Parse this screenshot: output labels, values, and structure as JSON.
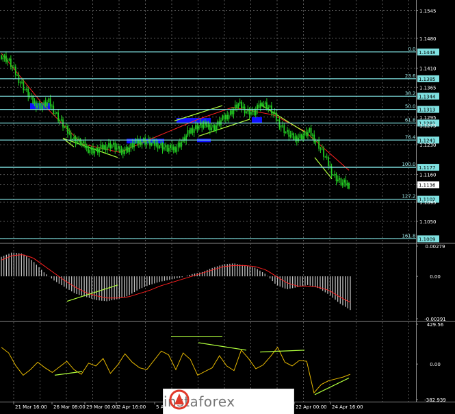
{
  "colors": {
    "background": "#000000",
    "grid": "#5a5a5a",
    "candle": "#22cc22",
    "fib": "#7fe0e0",
    "fib_label_bg": "#7fe0e0",
    "ma": "#ff2020",
    "trend": "#b0ff3c",
    "zone": "#1010ff",
    "histogram": "#bfbfbf",
    "signal": "#ff2020",
    "oscillator": "#e6b800",
    "divergence": "#b0ff3c",
    "watermark_bg": "#ffffff",
    "watermark_text": "#777777"
  },
  "chart_data": [
    {
      "type": "candlestick",
      "panel": "main",
      "y_ticks": [
        "1.1545",
        "1.1480",
        "1.1410",
        "1.1365",
        "1.1295",
        "1.1275",
        "1.1230",
        "1.1160",
        "1.1136",
        "1.1095",
        "1.1050",
        "1.1009"
      ],
      "current_price": "1.1136",
      "fib_levels": [
        {
          "pct": "0.0",
          "price": "1.1448"
        },
        {
          "pct": "23.6",
          "price": "1.1385"
        },
        {
          "pct": "38.2",
          "price": "1.1344"
        },
        {
          "pct": "50.0",
          "price": "1.1313"
        },
        {
          "pct": "61.8",
          "price": "1.1281"
        },
        {
          "pct": "76.4",
          "price": "1.1241"
        },
        {
          "pct": "100.0",
          "price": "1.1177"
        },
        {
          "pct": "127.2",
          "price": "1.1102"
        },
        {
          "pct": "161.8",
          "price": "1.1009"
        }
      ],
      "close_path": [
        [
          0,
          1.144
        ],
        [
          5,
          1.1425
        ],
        [
          10,
          1.139
        ],
        [
          15,
          1.136
        ],
        [
          20,
          1.133
        ],
        [
          25,
          1.132
        ],
        [
          30,
          1.133
        ],
        [
          35,
          1.13
        ],
        [
          40,
          1.127
        ],
        [
          45,
          1.1245
        ],
        [
          50,
          1.1235
        ],
        [
          55,
          1.122
        ],
        [
          60,
          1.1215
        ],
        [
          65,
          1.1225
        ],
        [
          70,
          1.123
        ],
        [
          75,
          1.1215
        ],
        [
          80,
          1.122
        ],
        [
          85,
          1.1235
        ],
        [
          90,
          1.124
        ],
        [
          95,
          1.1232
        ],
        [
          100,
          1.123
        ],
        [
          105,
          1.122
        ],
        [
          110,
          1.1222
        ],
        [
          115,
          1.124
        ],
        [
          120,
          1.1265
        ],
        [
          125,
          1.1275
        ],
        [
          130,
          1.1275
        ],
        [
          135,
          1.127
        ],
        [
          140,
          1.129
        ],
        [
          145,
          1.1305
        ],
        [
          150,
          1.1325
        ],
        [
          155,
          1.131
        ],
        [
          160,
          1.1305
        ],
        [
          165,
          1.133
        ],
        [
          170,
          1.1315
        ],
        [
          175,
          1.1285
        ],
        [
          180,
          1.126
        ],
        [
          185,
          1.1245
        ],
        [
          190,
          1.125
        ],
        [
          195,
          1.126
        ],
        [
          200,
          1.1235
        ],
        [
          205,
          1.12
        ],
        [
          210,
          1.116
        ],
        [
          215,
          1.114
        ],
        [
          220,
          1.1136
        ]
      ],
      "x_max": 220
    },
    {
      "type": "bar",
      "panel": "macd",
      "y_ticks": [
        "0.00279",
        "0.00",
        "-0.00391"
      ],
      "values": [
        0.0018,
        0.0022,
        0.0021,
        0.0014,
        0.0004,
        -0.0004,
        -0.001,
        -0.0016,
        -0.0019,
        -0.0022,
        -0.0023,
        -0.0021,
        -0.0018,
        -0.0012,
        -0.0008,
        -0.0005,
        -0.0003,
        -0.0001,
        0.0002,
        0.0004,
        0.0008,
        0.0011,
        0.0012,
        0.001,
        0.0008,
        0.0002,
        -0.0008,
        -0.0012,
        -0.001,
        -0.0008,
        -0.0011,
        -0.0017,
        -0.0025,
        -0.0031
      ],
      "signal": [
        0.0015,
        0.0019,
        0.002,
        0.0017,
        0.001,
        0.0003,
        -0.0004,
        -0.001,
        -0.0015,
        -0.0018,
        -0.002,
        -0.002,
        -0.0019,
        -0.0016,
        -0.0013,
        -0.0009,
        -0.0006,
        -0.0003,
        0.0,
        0.0003,
        0.0006,
        0.0009,
        0.001,
        0.001,
        0.0009,
        0.0006,
        0.0,
        -0.0006,
        -0.0009,
        -0.0009,
        -0.001,
        -0.0013,
        -0.0019,
        -0.0024
      ],
      "ylim": [
        -0.00391,
        0.00279
      ]
    },
    {
      "type": "line",
      "panel": "cci",
      "y_ticks": [
        "429.56",
        "0.00",
        "-382.939"
      ],
      "values": [
        180,
        120,
        -20,
        -120,
        -60,
        20,
        -40,
        -90,
        -30,
        30,
        -60,
        -110,
        10,
        -20,
        60,
        -100,
        -10,
        110,
        20,
        -40,
        -60,
        40,
        140,
        100,
        -60,
        120,
        50,
        -120,
        -80,
        -40,
        90,
        -20,
        -70,
        150,
        60,
        -50,
        -10,
        80,
        180,
        20,
        -20,
        40,
        30,
        -310,
        -220,
        -180,
        -160,
        -140,
        -110
      ],
      "ylim": [
        -382.939,
        429.56
      ]
    }
  ],
  "time_axis": [
    "21 Mar 16:00",
    "26 Mar 08:00",
    "29 Mar 00:00",
    "2 Apr 16:00",
    "5 Apr",
    "22 Apr 00:00",
    "24 Apr 16:00"
  ],
  "watermark": {
    "text": "instaforex"
  }
}
